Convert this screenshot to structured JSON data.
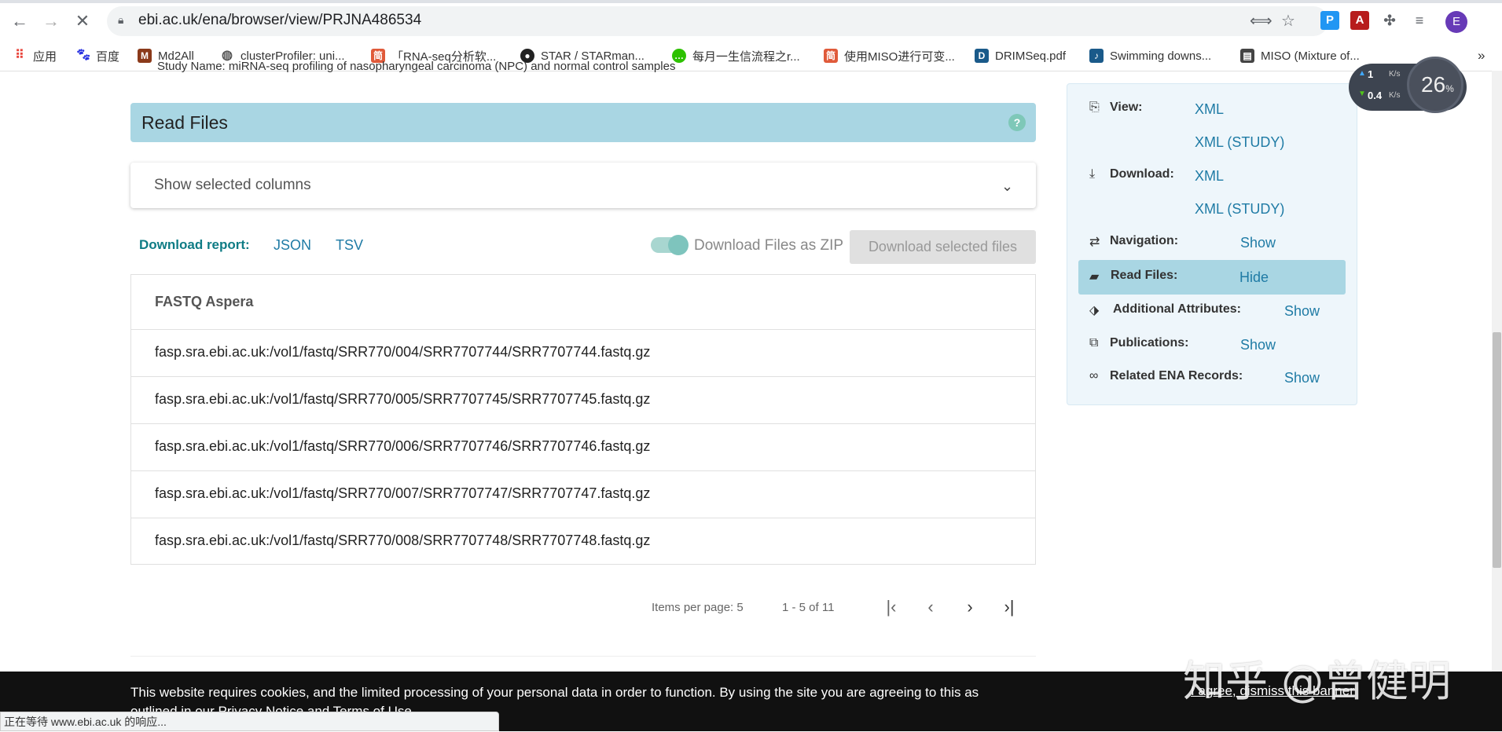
{
  "browser": {
    "url": "ebi.ac.uk/ena/browser/view/PRJNA486534",
    "avatar_letter": "E",
    "bookmarks": [
      {
        "label": "应用",
        "icon": "apps-grid-icon",
        "color": "#e8453c"
      },
      {
        "label": "百度",
        "icon": "baidu-paw-icon",
        "color": "#2932e1"
      },
      {
        "label": "Md2All",
        "icon": "md2all-icon",
        "color": "#8b3a1a"
      },
      {
        "label": "clusterProfiler: uni...",
        "icon": "globe-icon",
        "color": "#555555"
      },
      {
        "label": "「RNA-seq分析软...",
        "icon": "jian-icon",
        "color": "#e05a3a"
      },
      {
        "label": "STAR / STARman...",
        "icon": "github-icon",
        "color": "#222222"
      },
      {
        "label": "每月一生信流程之r...",
        "icon": "wechat-icon",
        "color": "#2dc100"
      },
      {
        "label": "使用MISO进行可变...",
        "icon": "jian-icon",
        "color": "#e05a3a"
      },
      {
        "label": "DRIMSeq.pdf",
        "icon": "pdf-icon",
        "color": "#1a5a8a"
      },
      {
        "label": "Swimming downs...",
        "icon": "music-icon",
        "color": "#1a5a8a"
      },
      {
        "label": "MISO (Mixture of...",
        "icon": "doc-icon",
        "color": "#444444"
      }
    ],
    "bookmarks_more": "»",
    "status": "正在等待 www.ebi.ac.uk 的响应..."
  },
  "page": {
    "study_name_row": "    Study Name:                                    miRNA-seq profiling of nasopharyngeal carcinoma (NPC) and normal control samples",
    "read_files_title": "Read Files",
    "help": "?",
    "columns_label": "Show selected columns",
    "download_report_label": "Download report:",
    "download_json": "JSON",
    "download_tsv": "TSV",
    "zip_label": "Download Files as ZIP",
    "download_selected": "Download selected files",
    "table": {
      "header": "FASTQ Aspera",
      "rows": [
        "fasp.sra.ebi.ac.uk:/vol1/fastq/SRR770/004/SRR7707744/SRR7707744.fastq.gz",
        "fasp.sra.ebi.ac.uk:/vol1/fastq/SRR770/005/SRR7707745/SRR7707745.fastq.gz",
        "fasp.sra.ebi.ac.uk:/vol1/fastq/SRR770/006/SRR7707746/SRR7707746.fastq.gz",
        "fasp.sra.ebi.ac.uk:/vol1/fastq/SRR770/007/SRR7707747/SRR7707747.fastq.gz",
        "fasp.sra.ebi.ac.uk:/vol1/fastq/SRR770/008/SRR7707748/SRR7707748.fastq.gz"
      ]
    },
    "pagination": {
      "items_per_page": "Items per page: 5",
      "range": "1 - 5 of 11"
    }
  },
  "sidebar": {
    "view_label": "View:",
    "view_xml": "XML",
    "view_xml_study": "XML (STUDY)",
    "download_label": "Download:",
    "download_xml": "XML",
    "download_xml_study": "XML (STUDY)",
    "navigation_label": "Navigation:",
    "navigation_link": "Show",
    "read_files_label": "Read Files:",
    "read_files_link": "Hide",
    "additional_label": "Additional Attributes:",
    "additional_link": "Show",
    "publications_label": "Publications:",
    "publications_link": "Show",
    "related_label": "Related ENA Records:",
    "related_link": "Show"
  },
  "speed_widget": {
    "up": "1",
    "down": "0.4",
    "unit": "K/s",
    "percent": "26",
    "percent_sign": "%"
  },
  "cookie": {
    "text": "This website requires cookies, and the limited processing of your personal data in order to function. By using the site you are agreeing to this as outlined in our Privacy Notice and Terms of Use.",
    "accept": "I agree, dismiss this banner"
  },
  "watermark": "知乎 @曾健明"
}
